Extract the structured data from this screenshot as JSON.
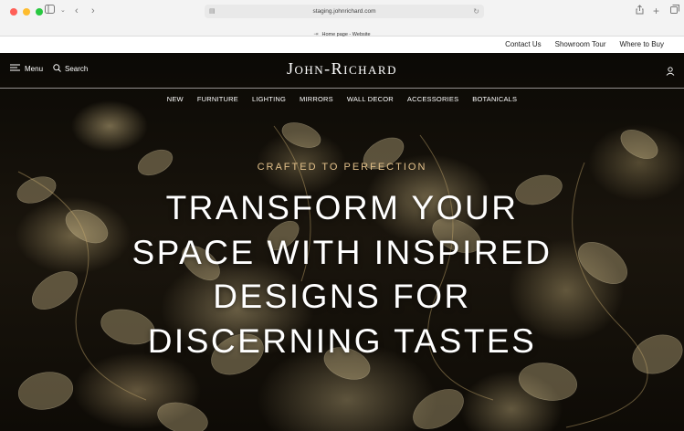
{
  "browser": {
    "url": "staging.johnrichard.com",
    "tab_title": "Home page - Website"
  },
  "utility_nav": {
    "items": [
      "Contact Us",
      "Showroom Tour",
      "Where to Buy"
    ]
  },
  "header": {
    "menu_label": "Menu",
    "search_label": "Search",
    "logo": "John-Richard"
  },
  "categories": [
    "NEW",
    "FURNITURE",
    "LIGHTING",
    "MIRRORS",
    "WALL DECOR",
    "ACCESSORIES",
    "BOTANICALS"
  ],
  "hero": {
    "eyebrow": "CRAFTED TO PERFECTION",
    "headline": "TRANSFORM YOUR SPACE WITH INSPIRED DESIGNS FOR DISCERNING TASTES"
  },
  "colors": {
    "accent_gold": "#e2c08a",
    "hero_text": "#ffffff",
    "utility_bg": "#ffffff"
  }
}
